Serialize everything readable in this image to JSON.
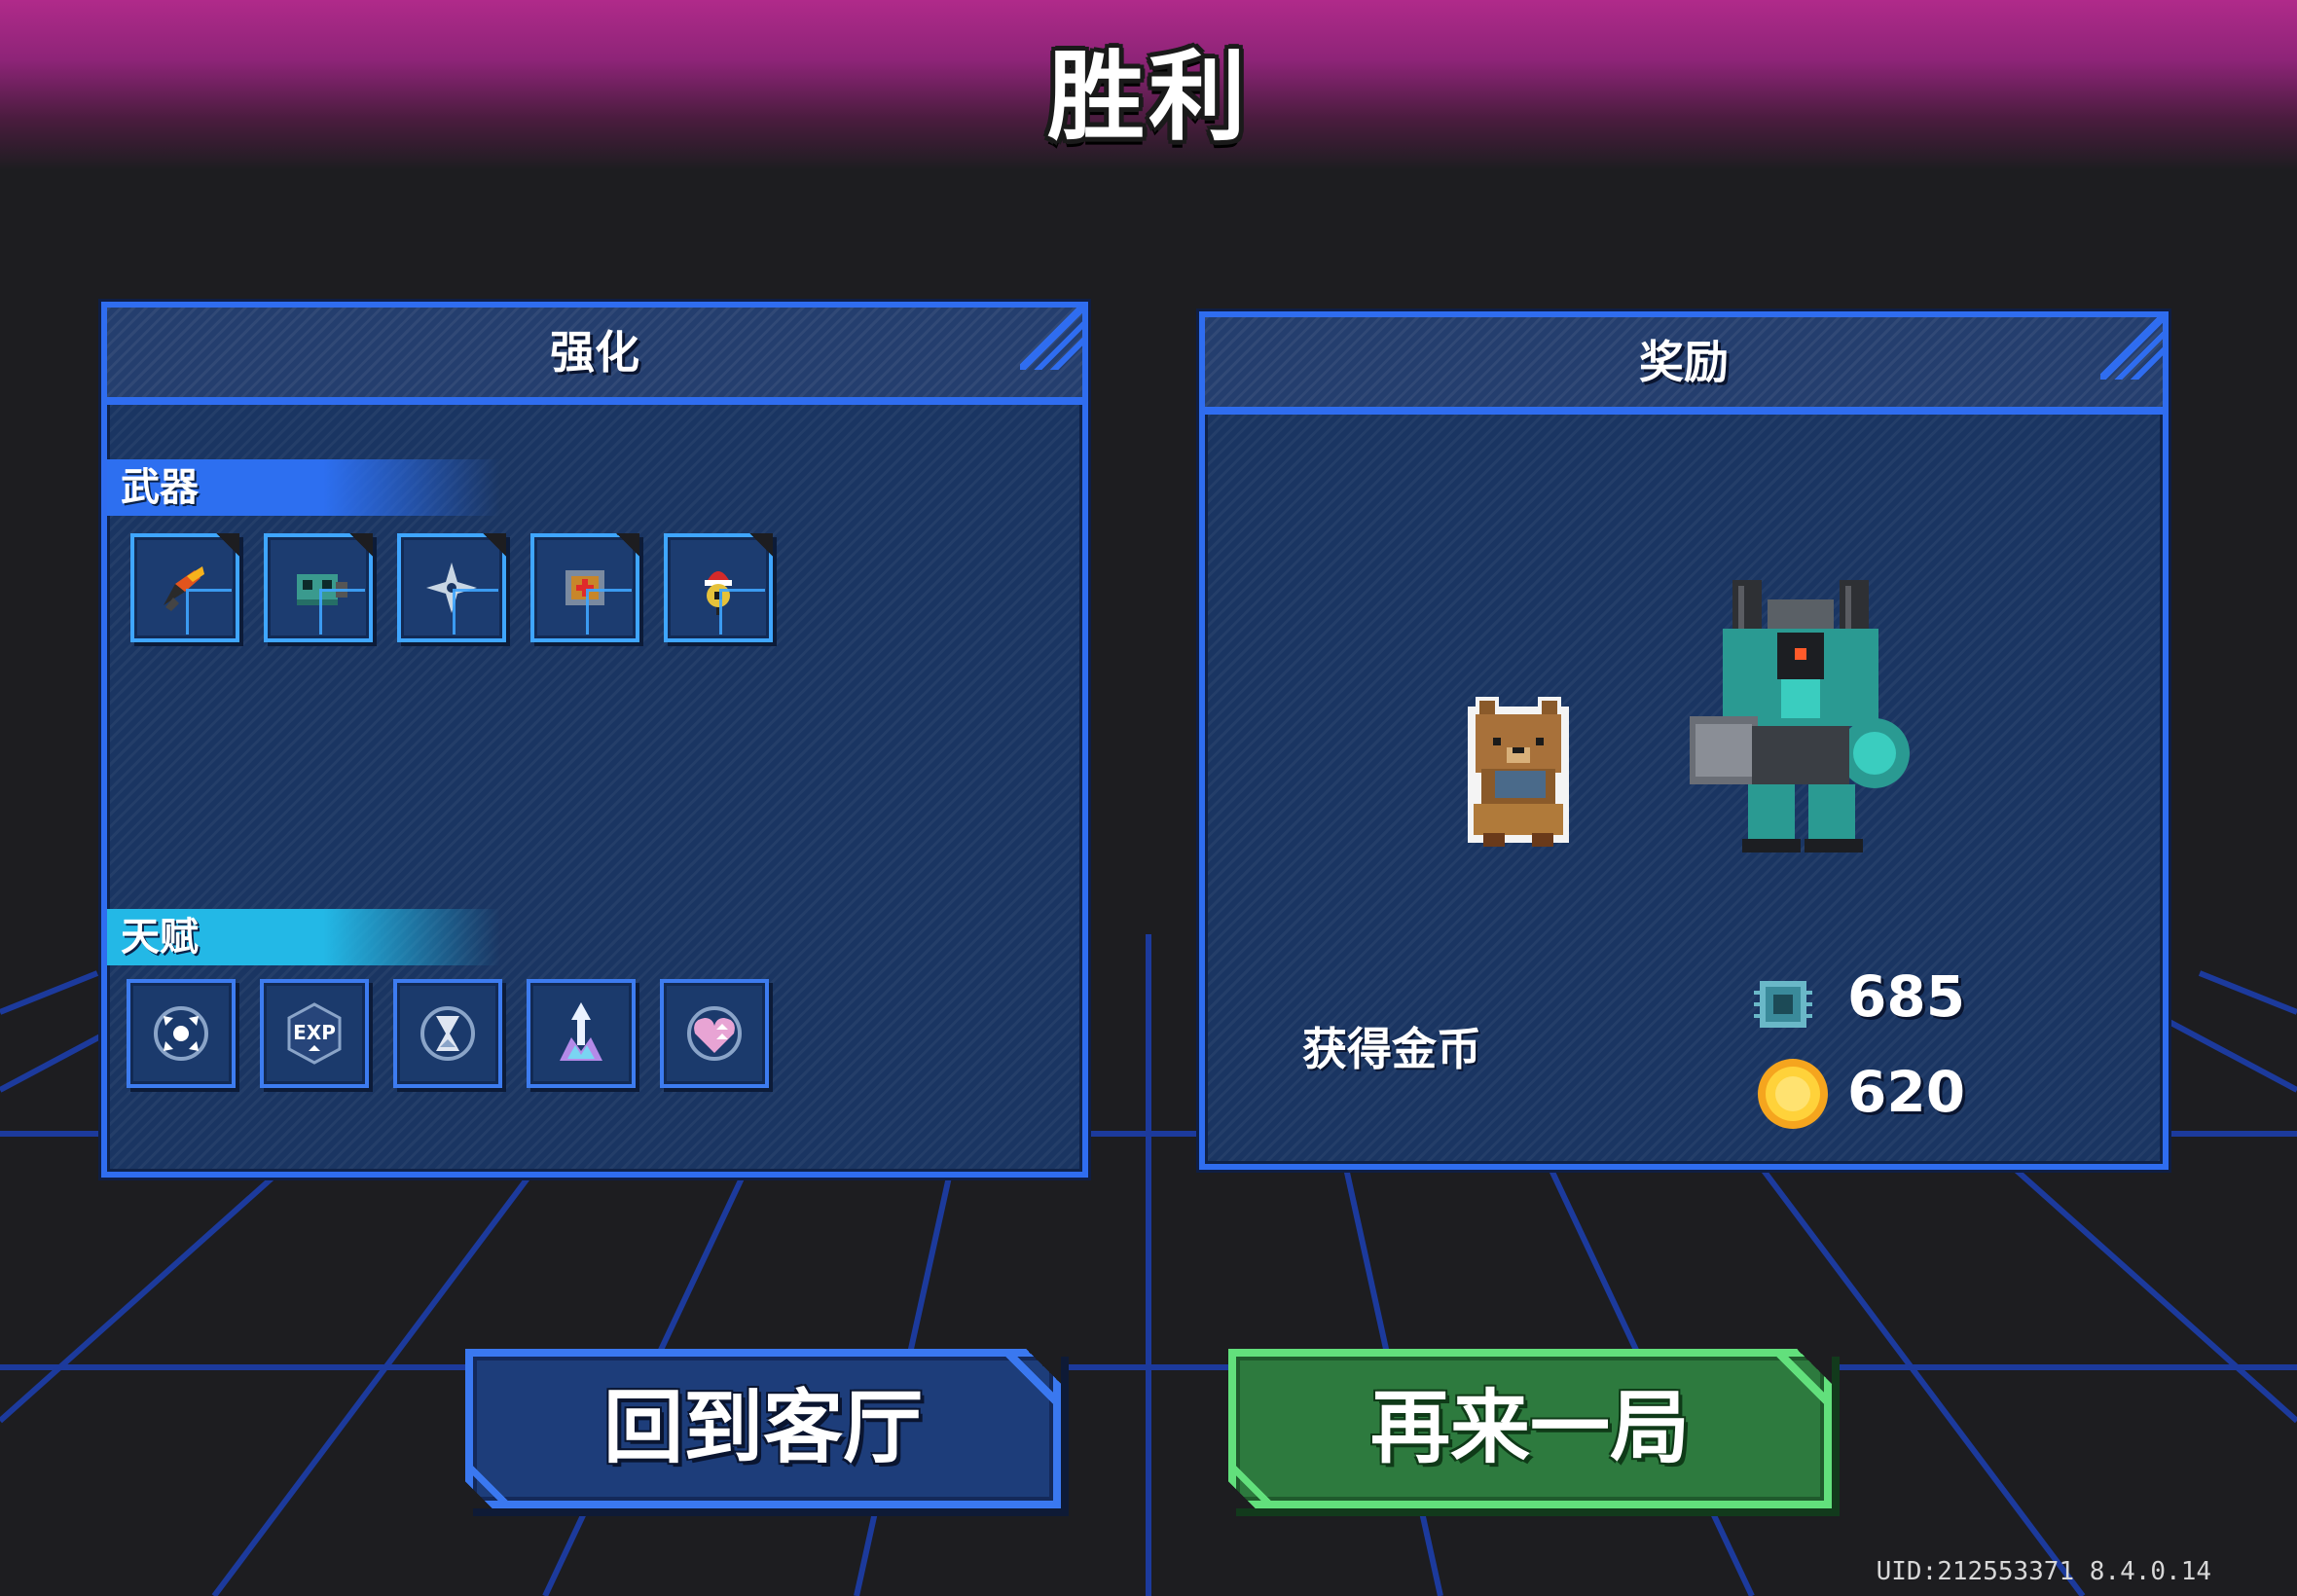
{
  "title": "胜利",
  "enhance_panel": {
    "title": "强化",
    "weapons_label": "武器",
    "talents_label": "天赋",
    "weapons": [
      {
        "icon": "flame-claw-icon"
      },
      {
        "icon": "robot-cannon-icon"
      },
      {
        "icon": "shuriken-icon"
      },
      {
        "icon": "medkit-box-icon"
      },
      {
        "icon": "santa-bomb-icon"
      }
    ],
    "talents": [
      {
        "icon": "spread-arrows-icon"
      },
      {
        "icon": "exp-up-icon",
        "text": "EXP"
      },
      {
        "icon": "hourglass-icon"
      },
      {
        "icon": "crystal-arrow-icon"
      },
      {
        "icon": "heart-shield-icon"
      }
    ]
  },
  "reward_panel": {
    "title": "奖励",
    "gold_label": "获得金币",
    "chip_value": "685",
    "coin_value": "620"
  },
  "buttons": {
    "back_to_lobby": "回到客厅",
    "play_again": "再来一局"
  },
  "footer": {
    "uid": "UID:212553371 8.4.0.14"
  },
  "colors": {
    "banner": "#b02a8a",
    "panel_border": "#2f6df0",
    "panel_fill": "#1a3562",
    "weapons_tag": "#2d6ff0",
    "talents_tag": "#23b8e6",
    "again_button": "#2d7a3e",
    "lobby_button": "#1d3d7a"
  }
}
